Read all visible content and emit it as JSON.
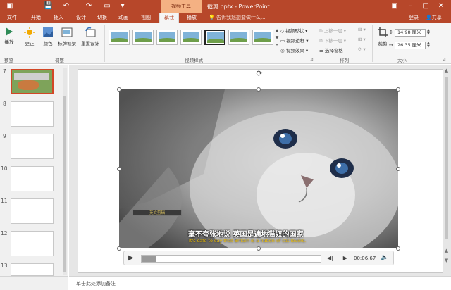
{
  "titlebar": {
    "context_tool_label": "视频工具",
    "document_title": "截剪.pptx - PowerPoint",
    "quick_access_icons": [
      "save-icon",
      "undo-icon",
      "redo-icon",
      "present-icon",
      "customize-icon"
    ],
    "window_controls": [
      "restore-ribbon-icon",
      "minimize-icon",
      "maximize-icon",
      "close-icon"
    ]
  },
  "tabs": {
    "items": [
      "文件",
      "开始",
      "插入",
      "设计",
      "切换",
      "动画",
      "视图",
      "格式",
      "播放"
    ],
    "active": "格式",
    "tell_me": "告诉我您想要做什么...",
    "login": "登录",
    "share": "共享"
  },
  "ribbon": {
    "preview": {
      "play_label": "播放",
      "group_label": "预览"
    },
    "adjust": {
      "corrections_label": "更正",
      "color_label": "颜色",
      "poster_frame_label": "标牌框架",
      "reset_design_label": "重置设计",
      "group_label": "调整"
    },
    "styles": {
      "group_label": "视频样式",
      "thumb_count": 7
    },
    "video_format": {
      "shape_label": "视频形状",
      "border_label": "视频边框",
      "effects_label": "视频效果"
    },
    "arrange": {
      "bring_forward": "上移一层",
      "send_backward": "下移一层",
      "selection_pane": "选择窗格",
      "group_label": "排列"
    },
    "size": {
      "crop_label": "裁剪",
      "height_value": "14.98 厘米",
      "width_value": "26.35 厘米",
      "group_label": "大小"
    }
  },
  "slides": {
    "numbers": [
      "7",
      "8",
      "9",
      "10",
      "11",
      "12",
      "13"
    ],
    "selected": "7"
  },
  "video": {
    "subtitle_cn": "毫不夸张地说 英国是遍地猫奴的国家",
    "subtitle_en": "It's safe to say that Britain is a nation of cat lovers.",
    "watermark": "英文剪辑",
    "time": "00:06.67",
    "progress": 0.08
  },
  "notes": {
    "placeholder": "单击此处添加备注"
  },
  "colors": {
    "accent": "#b7472a",
    "selected_border": "#d24726"
  }
}
